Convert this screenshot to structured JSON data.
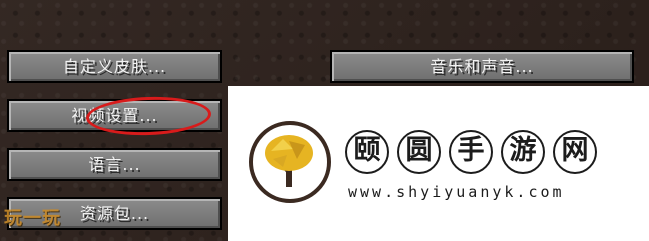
{
  "menu": {
    "buttons": [
      {
        "label": "自定义皮肤..."
      },
      {
        "label": "音乐和声音..."
      },
      {
        "label": "视频设置..."
      },
      {
        "label": "语言..."
      },
      {
        "label": "资源包..."
      }
    ]
  },
  "overlay": {
    "brand_chars": [
      "颐",
      "圆",
      "手",
      "游",
      "网"
    ],
    "url": "www.shyiyuanyk.com"
  },
  "watermark": {
    "text": "玩一玩"
  },
  "colors": {
    "background": "#2d211c",
    "button_face": "#7f7f7f",
    "highlight_circle": "#d81b1b",
    "logo_tree": "#e6b422"
  }
}
